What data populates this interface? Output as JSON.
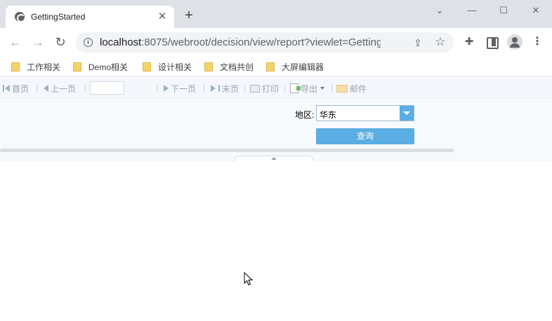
{
  "tab": {
    "title": "GettingStarted",
    "close": "✕",
    "new_tab": "+"
  },
  "window_controls": {
    "tab_search": "⌄",
    "minimize": "—",
    "maximize": "☐",
    "close": "✕"
  },
  "nav": {
    "back": "←",
    "forward": "→",
    "reload": "↻"
  },
  "address": {
    "host": "localhost",
    "rest": ":8075/webroot/decision/view/report?viewlet=Getting..."
  },
  "bookmarks": [
    {
      "label": "工作相关"
    },
    {
      "label": "Demo相关"
    },
    {
      "label": "设计相关"
    },
    {
      "label": "文档共创"
    },
    {
      "label": "大屏编辑器"
    }
  ],
  "report_toolbar": {
    "first_page": "首页",
    "prev_page": "上一页",
    "next_page": "下一页",
    "last_page": "末页",
    "print": "打印",
    "export": "导出",
    "email": "邮件"
  },
  "params": {
    "region_label": "地区:",
    "region_value": "华东",
    "query_button": "查询"
  },
  "colors": {
    "accent": "#5aaee3",
    "toolbar_bg": "#f4f7fb",
    "panel_bg": "#f7fafd"
  }
}
